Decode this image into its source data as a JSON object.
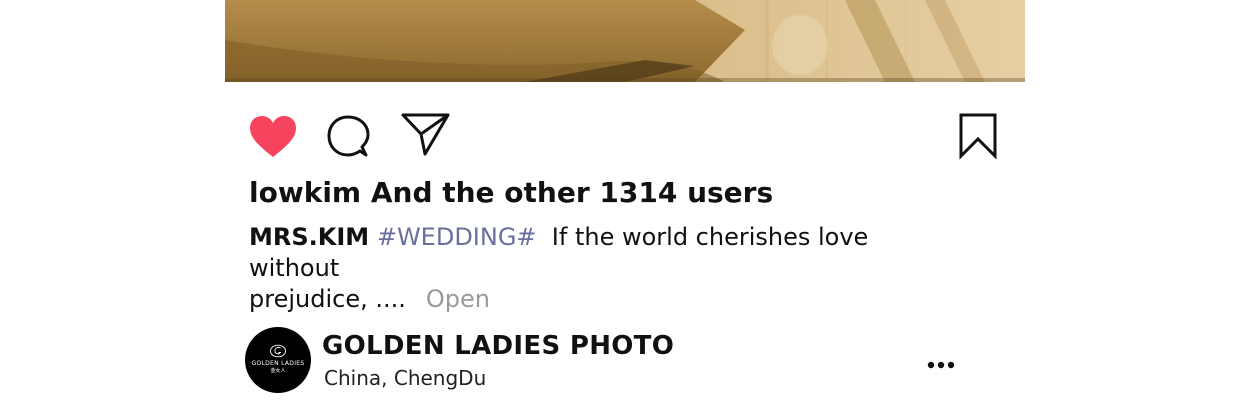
{
  "post": {
    "likes_text": "lowkim And the other 1314 users",
    "caption": {
      "username": "MRS.KIM",
      "hashtag": "#WEDDING#",
      "text_line1": "If the world cherishes love without",
      "text_line2": "prejudice, ....",
      "open_label": "Open"
    },
    "actions": {
      "like_icon": "heart-icon",
      "comment_icon": "comment-bubble-icon",
      "share_icon": "paper-plane-icon",
      "save_icon": "bookmark-icon",
      "liked": true,
      "like_color": "#f7445e"
    }
  },
  "account": {
    "name": "GOLDEN LADIES PHOTO",
    "country": "China,",
    "city": "ChengDu",
    "logo_text": "GOLDEN LADIES",
    "logo_sub": "金女人",
    "more_icon": "more-dots-icon"
  },
  "colors": {
    "hashtag": "#6a6f9c",
    "open_link": "#9a9a9a",
    "text": "#111111"
  }
}
